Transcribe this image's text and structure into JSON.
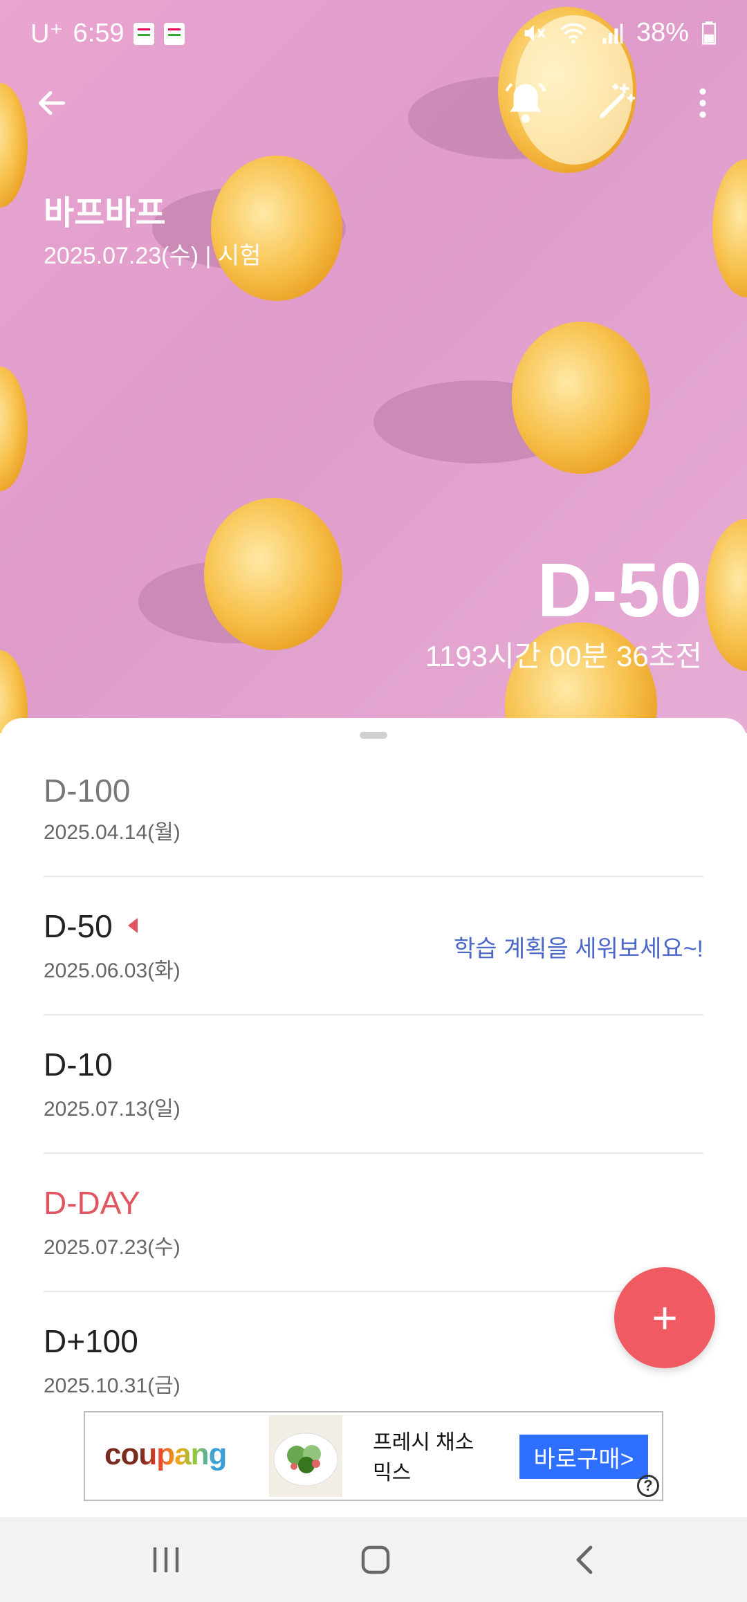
{
  "status_bar": {
    "carrier": "U⁺",
    "time": "6:59",
    "battery": "38%"
  },
  "header": {
    "title": "바프바프",
    "subtitle": "2025.07.23(수)  |  시험",
    "d_value": "D-50",
    "countdown": "1193시간 00분 36초전",
    "icons": [
      "back-arrow-icon",
      "bell-icon",
      "magic-wand-icon",
      "more-vert-icon"
    ]
  },
  "milestones": [
    {
      "label": "D-100",
      "date": "2025.04.14(월)",
      "color": "#777777"
    },
    {
      "label": "D-50",
      "date": "2025.06.03(화)",
      "color": "#222222",
      "current": true,
      "hint": "학습 계획을 세워보세요~!"
    },
    {
      "label": "D-10",
      "date": "2025.07.13(일)",
      "color": "#222222"
    },
    {
      "label": "D-DAY",
      "date": "2025.07.23(수)",
      "color": "#e05560"
    },
    {
      "label": "D+100",
      "date": "2025.10.31(금)",
      "color": "#222222"
    }
  ],
  "fab": {
    "label": "+"
  },
  "ad": {
    "brand": "coupang",
    "product": "프레시 채소믹스",
    "cta": "바로구매>",
    "help": "?"
  },
  "colors": {
    "accent": "#ef5a63",
    "hint_blue": "#4a67c9",
    "hero_pink": "#e3a2cf",
    "lemon": "#f6b83c"
  }
}
